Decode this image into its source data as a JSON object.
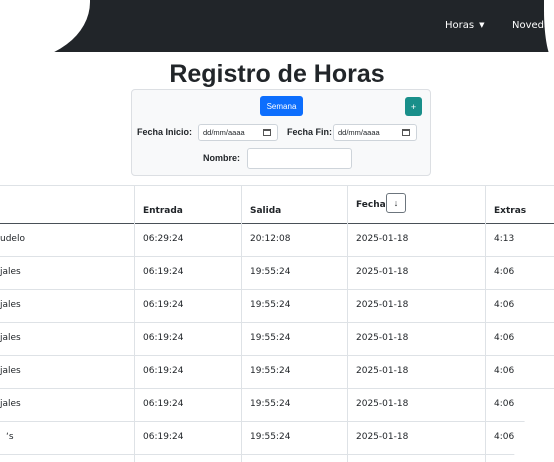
{
  "nav": {
    "items": [
      {
        "label": "Horas",
        "caret": "▼"
      },
      {
        "label": "Noveda"
      }
    ]
  },
  "page": {
    "title": "Registro de Horas"
  },
  "filters": {
    "semana_label": "Semana",
    "add_label": "+",
    "fecha_inicio_label": "Fecha Inicio:",
    "fecha_inicio_placeholder": "dd/mm/aaaa",
    "fecha_fin_label": "Fecha Fin:",
    "fecha_fin_placeholder": "dd/mm/aaaa",
    "nombre_label": "Nombre:",
    "nombre_value": ""
  },
  "table": {
    "headers": [
      "Entrada",
      "Salida",
      "Fecha",
      "Extras"
    ],
    "sort_icon": "↓",
    "rows": [
      {
        "name": "udelo",
        "entrada": "06:29:24",
        "salida": "20:12:08",
        "fecha": "2025-01-18",
        "extras": "4:13"
      },
      {
        "name": "jales",
        "entrada": "06:19:24",
        "salida": "19:55:24",
        "fecha": "2025-01-18",
        "extras": "4:06"
      },
      {
        "name": "jales",
        "entrada": "06:19:24",
        "salida": "19:55:24",
        "fecha": "2025-01-18",
        "extras": "4:06"
      },
      {
        "name": "jales",
        "entrada": "06:19:24",
        "salida": "19:55:24",
        "fecha": "2025-01-18",
        "extras": "4:06"
      },
      {
        "name": "jales",
        "entrada": "06:19:24",
        "salida": "19:55:24",
        "fecha": "2025-01-18",
        "extras": "4:06"
      },
      {
        "name": "jales",
        "entrada": "06:19:24",
        "salida": "19:55:24",
        "fecha": "2025-01-18",
        "extras": "4:06"
      },
      {
        "name": "‘s",
        "entrada": "06:19:24",
        "salida": "19:55:24",
        "fecha": "2025-01-18",
        "extras": "4:06"
      }
    ]
  }
}
